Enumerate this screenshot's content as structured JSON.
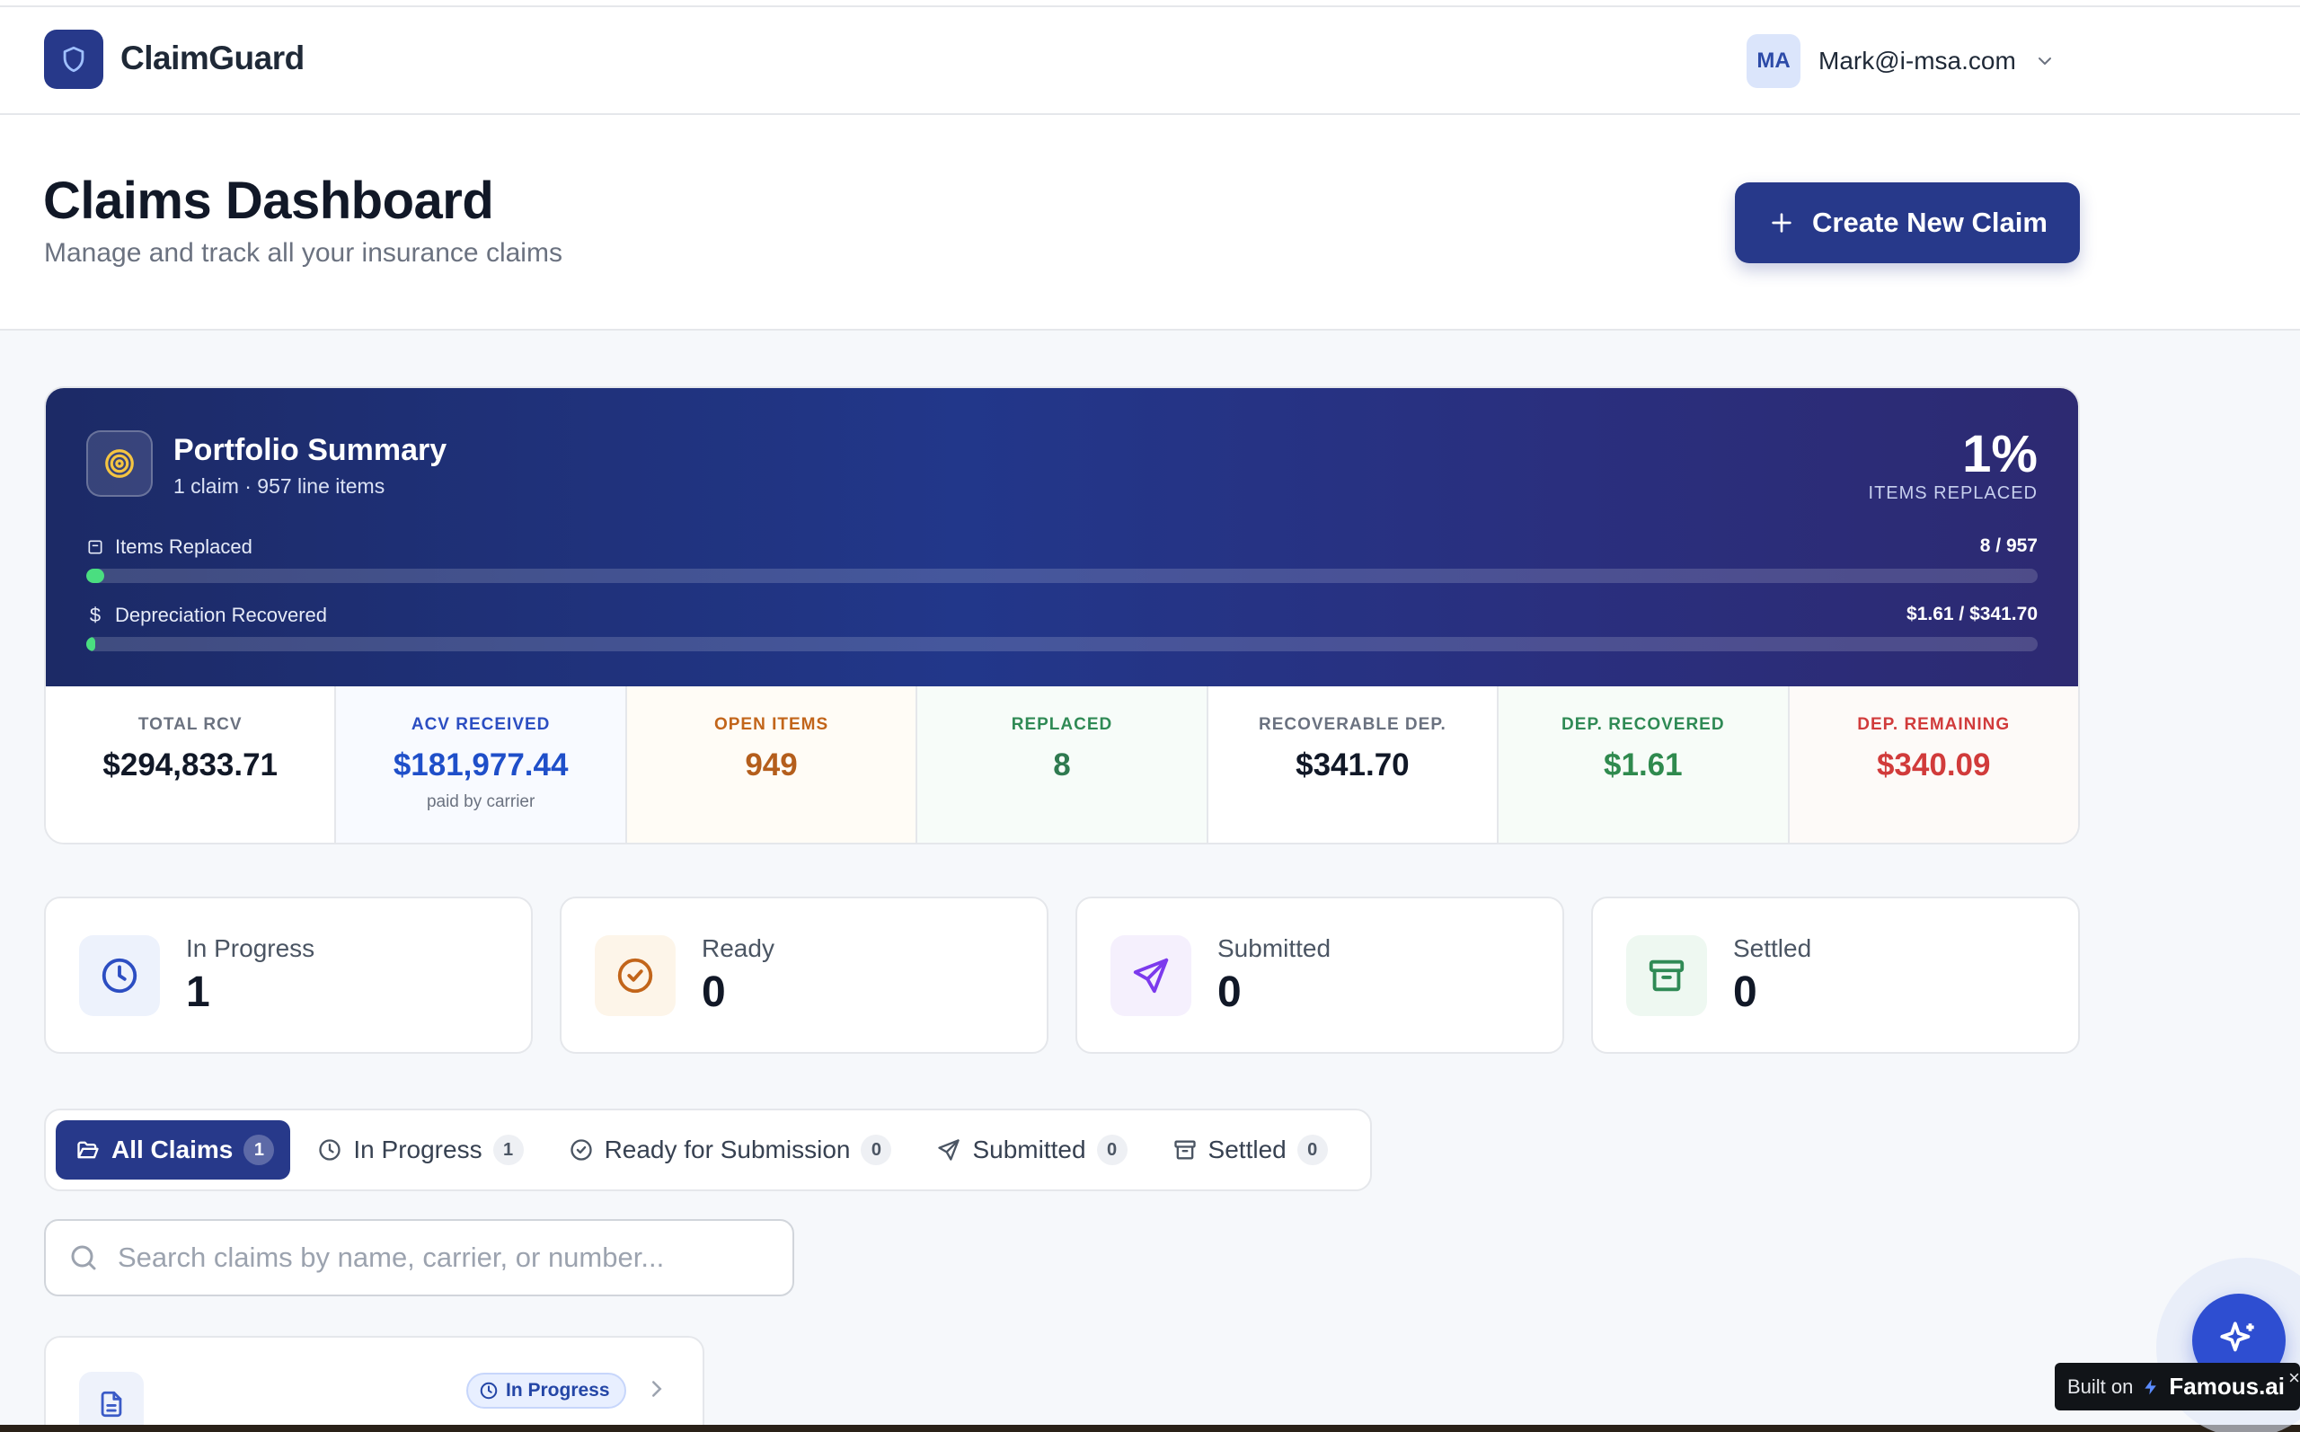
{
  "app": {
    "name": "ClaimGuard"
  },
  "user": {
    "initials": "MA",
    "email": "Mark@i-msa.com"
  },
  "page": {
    "title": "Claims Dashboard",
    "subtitle": "Manage and track all your insurance claims",
    "create_button": "Create New Claim"
  },
  "portfolio": {
    "title": "Portfolio Summary",
    "subtitle": "1 claim · 957 line items",
    "percent": "1%",
    "percent_label": "ITEMS REPLACED",
    "items_replaced": {
      "label": "Items Replaced",
      "value": "8 / 957",
      "progress": 0.0084
    },
    "depreciation": {
      "label": "Depreciation Recovered",
      "value": "$1.61 / $341.70",
      "progress": 0.0047
    },
    "stats": [
      {
        "label": "TOTAL RCV",
        "value": "$294,833.71",
        "note": "",
        "color": "#111827",
        "label_color": "#6b7280",
        "bg": "#ffffff"
      },
      {
        "label": "ACV RECEIVED",
        "value": "$181,977.44",
        "note": "paid by carrier",
        "color": "#1f4fc9",
        "label_color": "#2c4ec2",
        "bg": "#f8faff"
      },
      {
        "label": "OPEN ITEMS",
        "value": "949",
        "note": "",
        "color": "#b45e1c",
        "label_color": "#c2651a",
        "bg": "#fffcf6"
      },
      {
        "label": "REPLACED",
        "value": "8",
        "note": "",
        "color": "#2f7a50",
        "label_color": "#2f8a55",
        "bg": "#f7fcf9"
      },
      {
        "label": "RECOVERABLE DEP.",
        "value": "$341.70",
        "note": "",
        "color": "#111827",
        "label_color": "#6b7280",
        "bg": "#ffffff"
      },
      {
        "label": "DEP. RECOVERED",
        "value": "$1.61",
        "note": "",
        "color": "#2f8a4e",
        "label_color": "#2f8a55",
        "bg": "#f7fcf8"
      },
      {
        "label": "DEP. REMAINING",
        "value": "$340.09",
        "note": "",
        "color": "#d13b3b",
        "label_color": "#d13b3b",
        "bg": "#fdfaf8"
      }
    ]
  },
  "status_cards": [
    {
      "label": "In Progress",
      "value": "1",
      "icon": "clock-icon",
      "color": "#2c4ec2",
      "bg": "#edf2fc"
    },
    {
      "label": "Ready",
      "value": "0",
      "icon": "check-circle-icon",
      "color": "#c2651a",
      "bg": "#fdf5e9"
    },
    {
      "label": "Submitted",
      "value": "0",
      "icon": "send-icon",
      "color": "#7c3aed",
      "bg": "#f5f0fd"
    },
    {
      "label": "Settled",
      "value": "0",
      "icon": "archive-icon",
      "color": "#2f8a55",
      "bg": "#eef8f1"
    }
  ],
  "tabs": [
    {
      "label": "All Claims",
      "count": "1",
      "icon": "folder-open-icon",
      "active": true
    },
    {
      "label": "In Progress",
      "count": "1",
      "icon": "clock-icon",
      "active": false
    },
    {
      "label": "Ready for Submission",
      "count": "0",
      "icon": "check-circle-icon",
      "active": false
    },
    {
      "label": "Submitted",
      "count": "0",
      "icon": "send-icon",
      "active": false
    },
    {
      "label": "Settled",
      "count": "0",
      "icon": "archive-icon",
      "active": false
    }
  ],
  "search": {
    "placeholder": "Search claims by name, carrier, or number...",
    "value": ""
  },
  "claim_card": {
    "status": "In Progress"
  },
  "badge": {
    "built_on": "Built on",
    "brand": "Famous.ai",
    "close": "×"
  },
  "colors": {
    "primary": "#27398a",
    "accent": "#2e4ed1",
    "progress_green": "#4ade80"
  }
}
